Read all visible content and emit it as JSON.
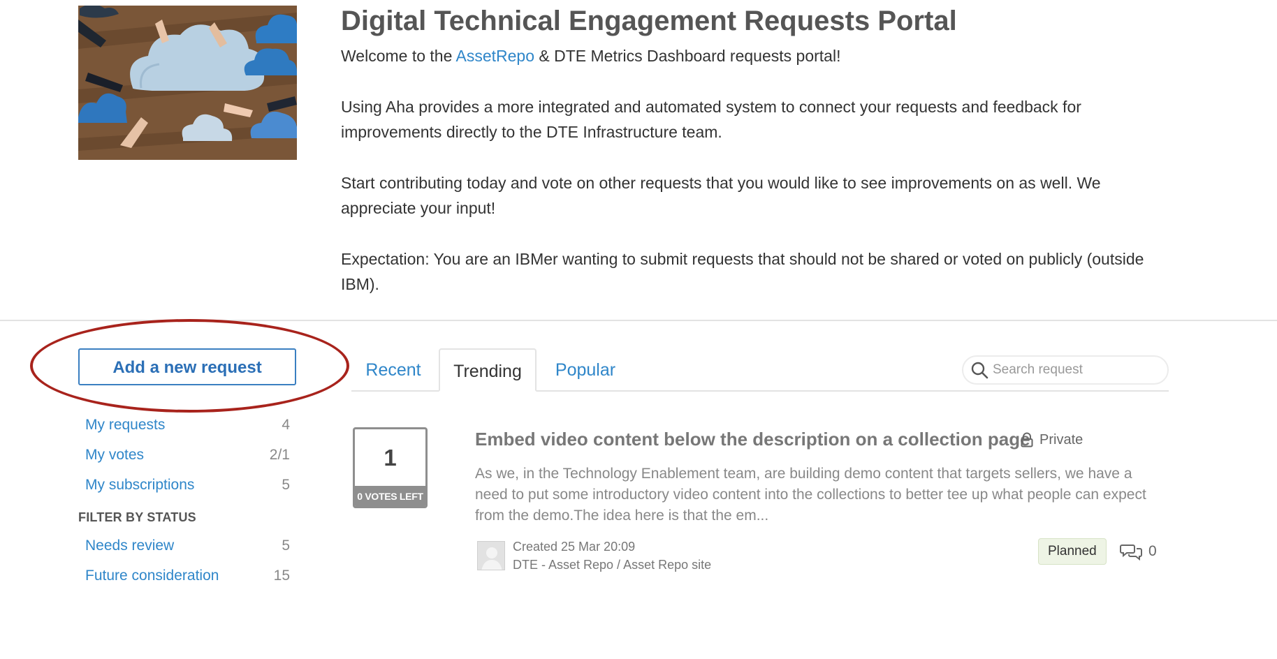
{
  "portal": {
    "title": "Digital Technical Engagement Requests Portal",
    "intro_prefix": "Welcome to the ",
    "intro_link": "AssetRepo",
    "intro_suffix": " & DTE Metrics Dashboard requests portal!",
    "paragraph_2": "Using Aha provides a more integrated and automated system to connect your requests and feedback for improvements directly to the DTE Infrastructure team.",
    "paragraph_3": "Start contributing today and vote on other requests that you would like to see improvements on as well. We appreciate your input!",
    "paragraph_4": "Expectation: You are an IBMer wanting to submit requests that should not be shared or voted on publicly (outside IBM)."
  },
  "sidebar": {
    "add_button": "Add a new request",
    "my_items": [
      {
        "label": "My requests",
        "count": "4"
      },
      {
        "label": "My votes",
        "count": "2/1"
      },
      {
        "label": "My subscriptions",
        "count": "5"
      }
    ],
    "filter_heading": "FILTER BY STATUS",
    "status_items": [
      {
        "label": "Needs review",
        "count": "5"
      },
      {
        "label": "Future consideration",
        "count": "15"
      }
    ]
  },
  "tabs": [
    {
      "label": "Recent"
    },
    {
      "label": "Trending"
    },
    {
      "label": "Popular"
    }
  ],
  "search": {
    "placeholder": "Search request"
  },
  "idea": {
    "votes": "1",
    "votes_left": "0 VOTES LEFT",
    "title": "Embed video content below the description on a collection page",
    "visibility": "Private",
    "description": "As we, in the Technology Enablement team, are building demo content that targets sellers, we have a need to put some introductory video content into the collections to better tee up what people can expect from the demo.The idea here is that the em...",
    "created": "Created 25 Mar 20:09",
    "category": "DTE - Asset Repo / Asset Repo site",
    "status": "Planned",
    "comment_count": "0"
  },
  "colors": {
    "link": "#2f86c9",
    "annotation": "#a8231c",
    "status_bg": "#eef4e5"
  }
}
